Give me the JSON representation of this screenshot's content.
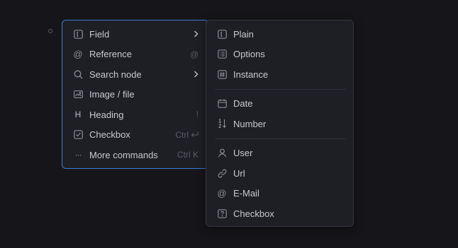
{
  "main_menu": {
    "items": [
      {
        "label": "Field",
        "icon": "field-icon",
        "shortcut": "",
        "has_submenu": true
      },
      {
        "label": "Reference",
        "icon": "at-icon",
        "shortcut": "@",
        "has_submenu": false
      },
      {
        "label": "Search node",
        "icon": "search-icon",
        "shortcut": "",
        "has_submenu": true
      },
      {
        "label": "Image / file",
        "icon": "image-icon",
        "shortcut": "",
        "has_submenu": false
      },
      {
        "label": "Heading",
        "icon": "heading-icon",
        "shortcut": "!",
        "has_submenu": false
      },
      {
        "label": "Checkbox",
        "icon": "checkbox-icon",
        "shortcut": "Ctrl",
        "has_submenu": false
      },
      {
        "label": "More commands",
        "icon": "ellipsis-icon",
        "shortcut": "Ctrl K",
        "has_submenu": false
      }
    ]
  },
  "field_submenu": {
    "groups": [
      [
        {
          "label": "Plain",
          "icon": "plain-field-icon"
        },
        {
          "label": "Options",
          "icon": "options-list-icon"
        },
        {
          "label": "Instance",
          "icon": "hash-icon"
        }
      ],
      [
        {
          "label": "Date",
          "icon": "calendar-icon"
        },
        {
          "label": "Number",
          "icon": "number-icon"
        }
      ],
      [
        {
          "label": "User",
          "icon": "user-icon"
        },
        {
          "label": "Url",
          "icon": "link-icon"
        },
        {
          "label": "E-Mail",
          "icon": "at-icon"
        },
        {
          "label": "Checkbox",
          "icon": "question-box-icon"
        }
      ]
    ]
  },
  "colors": {
    "background": "#16161a",
    "menu_bg": "#1e1f24",
    "focus_border": "#3c7bd9",
    "text": "#c9c9cf",
    "muted": "#5b5c64"
  }
}
